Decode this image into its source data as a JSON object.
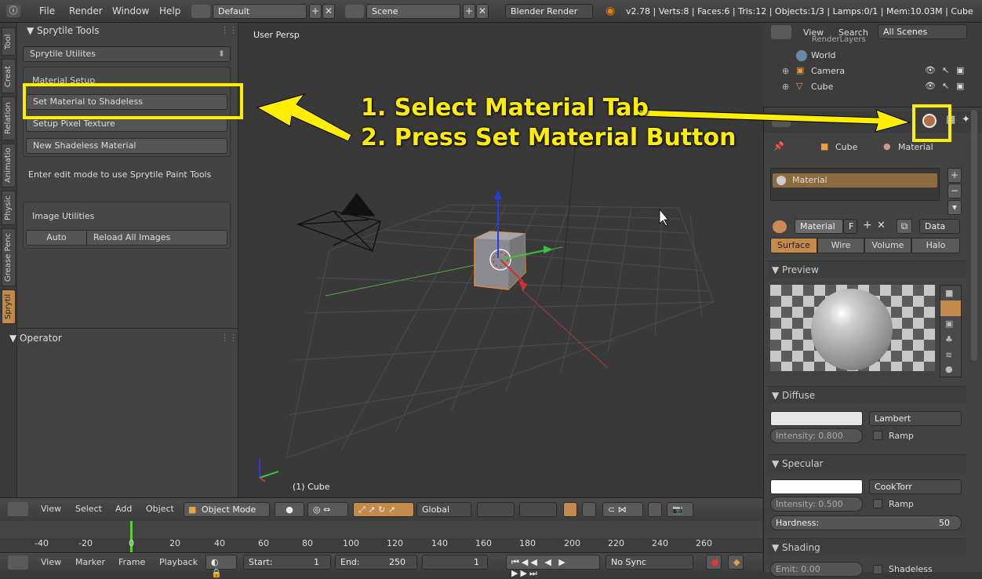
{
  "topbar": {
    "menus": [
      "File",
      "Render",
      "Window",
      "Help"
    ],
    "layout": "Default",
    "scene": "Scene",
    "engine": "Blender Render",
    "stats": "v2.78 | Verts:8 | Faces:6 | Tris:12 | Objects:1/3 | Lamps:0/1 | Mem:10.03M | Cube"
  },
  "toolshelf": {
    "tabs": [
      "Tool",
      "Creat",
      "Relation",
      "Animatio",
      "Physic",
      "Grease Penc",
      "Sprytil"
    ],
    "panel_title": "Sprytile Tools",
    "dropdown": "Sprytile Utilites",
    "material_setup_label": "Material Setup",
    "buttons": [
      "Set Material to Shadeless",
      "Setup Pixel Texture",
      "New Shadeless Material"
    ],
    "hint": "Enter edit mode to use Sprytile Paint Tools",
    "image_utils_label": "Image Utilities",
    "auto_label": "Auto",
    "reload_label": "Reload All Images",
    "operator_title": "Operator"
  },
  "viewport": {
    "label": "User Persp",
    "object_label": "(1) Cube"
  },
  "annotation": {
    "line1": "1. Select Material Tab",
    "line2": "2. Press Set Material Button"
  },
  "view3d_header": {
    "items": [
      "View",
      "Select",
      "Add",
      "Object"
    ],
    "mode": "Object Mode",
    "orientation": "Global"
  },
  "timeline": {
    "ticks": [
      "-40",
      "-20",
      "0",
      "20",
      "40",
      "60",
      "80",
      "100",
      "120",
      "140",
      "160",
      "180",
      "200",
      "220",
      "240",
      "260"
    ],
    "items": [
      "View",
      "Marker",
      "Frame",
      "Playback"
    ],
    "start_label": "Start:",
    "start": "1",
    "end_label": "End:",
    "end": "250",
    "current": "1",
    "sync": "No Sync"
  },
  "outliner": {
    "menus": [
      "View",
      "Search"
    ],
    "filter": "All Scenes",
    "rows": [
      "RenderLayers",
      "World",
      "Camera",
      "Cube"
    ]
  },
  "properties": {
    "breadcrumb": [
      "Cube",
      "Material"
    ],
    "slot": "Material",
    "mat_name": "Material",
    "f_label": "F",
    "data_label": "Data",
    "tabs": [
      "Surface",
      "Wire",
      "Volume",
      "Halo"
    ],
    "preview_title": "Preview",
    "diffuse_title": "Diffuse",
    "diffuse_shader": "Lambert",
    "diffuse_intensity": "Intensity:  0.800",
    "ramp": "Ramp",
    "specular_title": "Specular",
    "specular_shader": "CookTorr",
    "specular_intensity": "Intensity:  0.500",
    "hardness_label": "Hardness:",
    "hardness": "50",
    "shading_title": "Shading",
    "emit": "Emit:       0.00",
    "shadeless": "Shadeless"
  },
  "colors": {
    "accent": "#c48a4a",
    "annotation": "#ffee00",
    "selected": "#8c6b3f"
  }
}
